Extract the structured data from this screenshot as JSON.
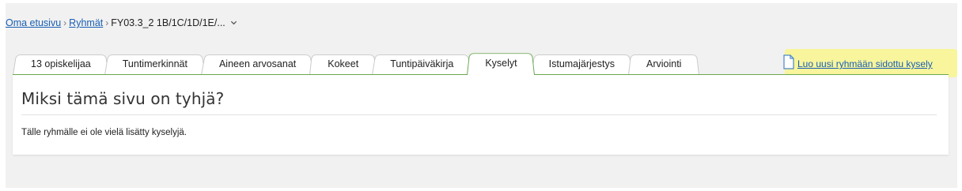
{
  "breadcrumb": {
    "home": "Oma etusivu",
    "groups": "Ryhmät",
    "current": "FY03.3_2 1B/1C/1D/1E/..."
  },
  "tabs": [
    {
      "label": "13 opiskelijaa",
      "active": false
    },
    {
      "label": "Tuntimerkinnät",
      "active": false
    },
    {
      "label": "Aineen arvosanat",
      "active": false
    },
    {
      "label": "Kokeet",
      "active": false
    },
    {
      "label": "Tuntipäiväkirja",
      "active": false
    },
    {
      "label": "Kyselyt",
      "active": true
    },
    {
      "label": "Istumajärjestys",
      "active": false
    },
    {
      "label": "Arviointi",
      "active": false
    }
  ],
  "actions": {
    "create_survey": "Luo uusi ryhmään sidottu kysely"
  },
  "panel": {
    "title": "Miksi tämä sivu on tyhjä?",
    "message": "Tälle ryhmälle ei ole vielä lisätty kyselyjä."
  },
  "colors": {
    "active_tab_border": "#6aa84f",
    "link": "#1a5fb4",
    "highlight": "#f8f59c",
    "background": "#f1f1f1"
  }
}
